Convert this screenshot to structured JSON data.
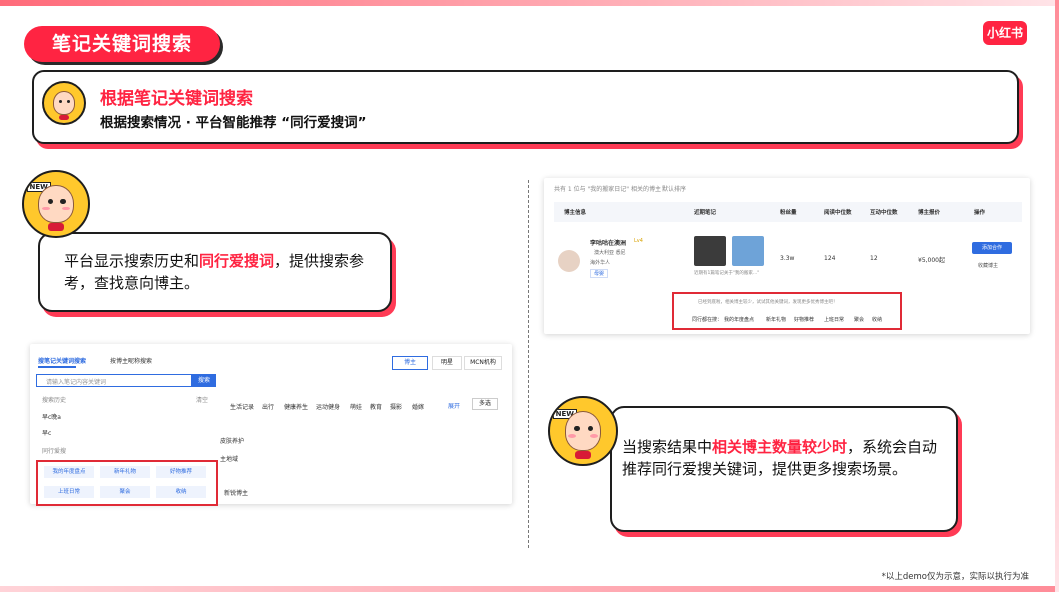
{
  "page": {
    "title": "笔记关键词搜索",
    "logo": "小红书",
    "footnote": "*以上demo仅为示意，实际以执行为准"
  },
  "header": {
    "title": "根据笔记关键词搜索",
    "subtitle": "根据搜索情况 · 平台智能推荐 “同行爱搜词”"
  },
  "bubble_left": {
    "part1": "平台显示搜索历史和",
    "highlight": "同行爱搜词",
    "part2": "，提供搜索参考，查找意向博主。"
  },
  "bubble_right": {
    "part1": "当搜索结果中",
    "highlight": "相关博主数量较少时",
    "part2": "，系统会自动推荐同行爱搜关键词，提供更多搜索场景。"
  },
  "left_shot": {
    "tab_active": "搜笔记关键词搜索",
    "tab_other": "按博主昵称搜索",
    "right_tabs": [
      "博主",
      "明星",
      "MCN机构"
    ],
    "search_placeholder": "请输入笔记内容关键词",
    "search_button": "搜索",
    "history_label": "搜索历史",
    "clear_label": "清空",
    "history_items": [
      "早c晚a",
      "早c"
    ],
    "peer_label": "同行爱搜",
    "peer_words": [
      "我的年度盘点",
      "新年礼物",
      "好物推荐",
      "上班日常",
      "聚会",
      "收纳"
    ],
    "categories": [
      "生活记录",
      "出行",
      "健康养生",
      "运动健身",
      "萌娃",
      "教育",
      "摄影",
      "婚嫁"
    ],
    "expand_label": "展开",
    "multi_label": "多选",
    "filter_1": "皮肤养护",
    "filter_2": "主地域",
    "filter_3": "新锐博主"
  },
  "right_shot": {
    "result_summary": "共有 1 位与 \"我的搬家日记\" 相关的博主",
    "sort_label": "默认排序",
    "headers": [
      "博主信息",
      "近期笔记",
      "粉丝量",
      "阅读中位数",
      "互动中位数",
      "博主报价",
      "操作"
    ],
    "row": {
      "name": "李咕咕在澳洲",
      "badge": "Lv4",
      "location": "澳大利亚 悉尼",
      "desc": "海外华人",
      "tag": "母婴",
      "note_caption": "近期有1篇笔记关于\"我的搬家...\"",
      "fans": "3.3w",
      "read_median": "124",
      "interact_median": "12",
      "price": "¥5,000起",
      "add_button": "添加合作",
      "fav_label": "收藏博主"
    },
    "empty_hint": "已经到底啦，相关博主较少，试试其他关键词，发现更多优秀博主吧！",
    "peer_prefix": "同行都在搜：",
    "peer_words": [
      "我的年度盘点",
      "新年礼物",
      "好物推荐",
      "上班日常",
      "聚会",
      "收纳"
    ]
  },
  "avatar_tag": "NEW",
  "colors": {
    "brand_red": "#ff2442",
    "link_blue": "#2f6ce0",
    "avatar_yellow": "#ffc82c"
  }
}
